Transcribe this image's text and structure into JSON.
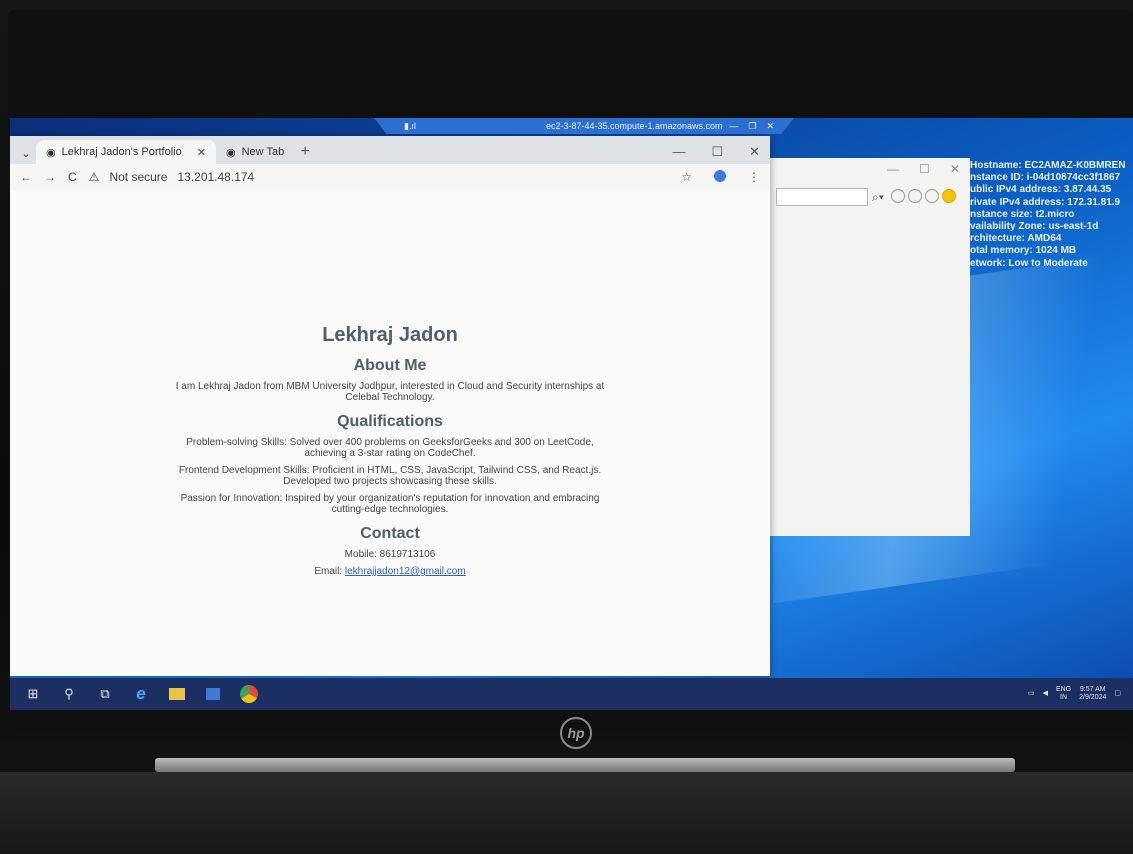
{
  "browser": {
    "tabs": [
      {
        "label": "Lekhraj Jadon's Portfolio",
        "active": true
      },
      {
        "label": "New Tab",
        "active": false
      }
    ],
    "security_label": "Not secure",
    "url": "13.201.48.174"
  },
  "rdp_bar": {
    "title": "ec2-3-87-44-35.compute-1.amazonaws.com"
  },
  "page": {
    "name": "Lekhraj Jadon",
    "about_heading": "About Me",
    "about_text": "I am Lekhraj Jadon from MBM University Jodhpur, interested in Cloud and Security internships at Celebal Technology.",
    "qualifications_heading": "Qualifications",
    "qualifications": [
      "Problem-solving Skills: Solved over 400 problems on GeeksforGeeks and 300 on LeetCode, achieving a 3-star rating on CodeChef.",
      "Frontend Development Skills: Proficient in HTML, CSS, JavaScript, Tailwind CSS, and React.js. Developed two projects showcasing these skills.",
      "Passion for Innovation: Inspired by your organization's reputation for innovation and embracing cutting-edge technologies."
    ],
    "contact_heading": "Contact",
    "mobile": "Mobile: 8619713106",
    "email_prefix": "Email: ",
    "email": "lekhrajjadon12@gmail.com"
  },
  "desktop_info": {
    "lines": [
      "Hostname: EC2AMAZ-K0BMREN",
      "nstance ID: i-04d10874cc3f1867",
      "ublic IPv4 address: 3.87.44.35",
      "rivate IPv4 address: 172.31.81.9",
      "nstance size: t2.micro",
      "vailability Zone: us-east-1d",
      "rchitecture: AMD64",
      "otal memory: 1024 MB",
      "etwork: Low to Moderate"
    ]
  },
  "taskbar": {
    "lang_top": "ENG",
    "lang_bottom": "IN",
    "time": "9:57 AM",
    "date": "2/9/2024"
  },
  "laptop": {
    "logo": "hp"
  },
  "colors": {
    "taskbar": "#1b2f63",
    "desktop": "#0b5fc4",
    "link": "#2b5fd9"
  }
}
